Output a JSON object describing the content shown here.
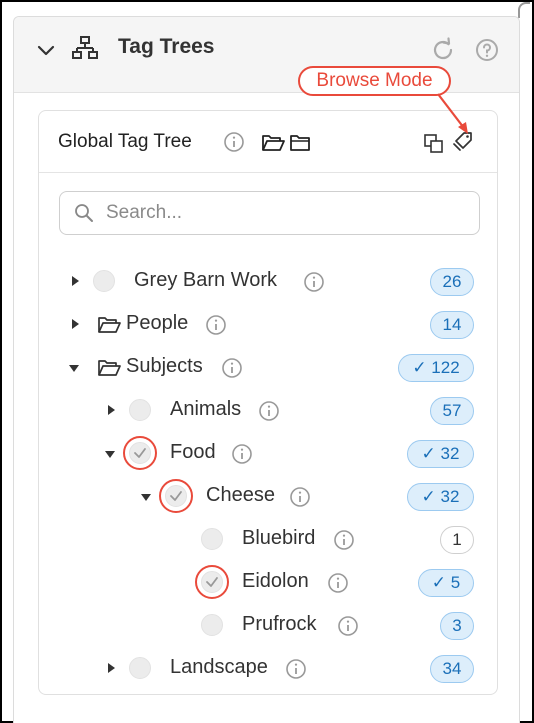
{
  "panel": {
    "title": "Tag Trees"
  },
  "callout": {
    "label": "Browse Mode"
  },
  "card": {
    "title": "Global Tag Tree"
  },
  "search": {
    "placeholder": "Search..."
  },
  "tree": [
    {
      "label": "Grey Barn Work",
      "count": "26"
    },
    {
      "label": "People",
      "count": "14"
    },
    {
      "label": "Subjects",
      "count": "122",
      "checked": true
    },
    {
      "label": "Animals",
      "count": "57"
    },
    {
      "label": "Food",
      "count": "32",
      "checked": true
    },
    {
      "label": "Cheese",
      "count": "32",
      "checked": true
    },
    {
      "label": "Bluebird",
      "count": "1"
    },
    {
      "label": "Eidolon",
      "count": "5",
      "checked": true
    },
    {
      "label": "Prufrock",
      "count": "3"
    },
    {
      "label": "Landscape",
      "count": "34"
    }
  ],
  "colors": {
    "accent_red": "#e94a3b",
    "badge_blue": "#1a6fb8",
    "badge_bg": "#ddeefb"
  }
}
